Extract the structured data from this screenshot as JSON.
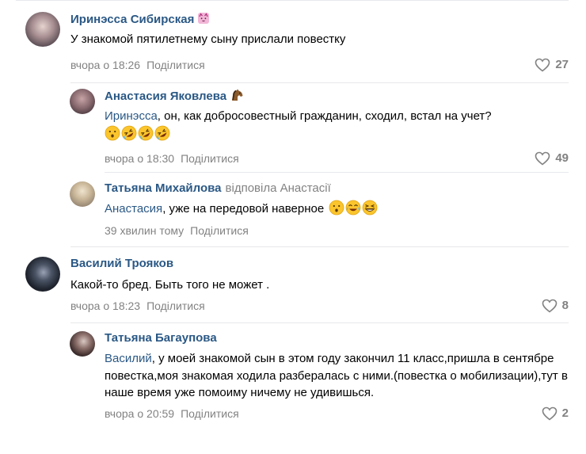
{
  "comments": [
    {
      "author": "Иринэсса Сибирская",
      "author_badge": "cat-face-emoji",
      "text": "У знакомой пятилетнему сыну прислали повестку",
      "time": "вчора о 18:26",
      "share_label": "Поділитися",
      "likes": "27"
    },
    {
      "author": "Анастасия Яковлева",
      "author_badge": "horse-emoji",
      "text_address": "Иринэсса",
      "text": ", он, как добросовестный гражданин, сходил, встал на учет?",
      "emojis": [
        "hushed-face-emoji",
        "rolling-laughing-emoji",
        "rolling-laughing-emoji",
        "rolling-laughing-emoji"
      ],
      "time": "вчора о 18:30",
      "share_label": "Поділитися",
      "likes": "49"
    },
    {
      "author": "Татьяна Михайлова",
      "reply_note": "відповіла Анастасії",
      "text_address": "Анастасия",
      "text": ", уже на передовой наверное",
      "emojis": [
        "hushed-face-emoji",
        "tears-of-joy-emoji",
        "grinning-squint-emoji"
      ],
      "time": "39 хвилин тому",
      "share_label": "Поділитися"
    },
    {
      "author": "Василий Трояков",
      "text": "Какой-то бред. Быть того не может .",
      "time": "вчора о 18:23",
      "share_label": "Поділитися",
      "likes": "8"
    },
    {
      "author": "Татьяна Багаупова",
      "text_address": "Василий",
      "text": ", у моей знакомой сын в этом году закончил 11 класс,пришла в сентябре повестка,моя знакомая ходила разбералась с ними.(повестка о мобилизации),тут в наше время уже помоиму ничему не удивишься.",
      "time": "вчора о 20:59",
      "share_label": "Поділитися",
      "likes": "2"
    }
  ],
  "colors": {
    "author": "#2a5885",
    "meta": "#828282",
    "divider": "#e7e8ec"
  }
}
